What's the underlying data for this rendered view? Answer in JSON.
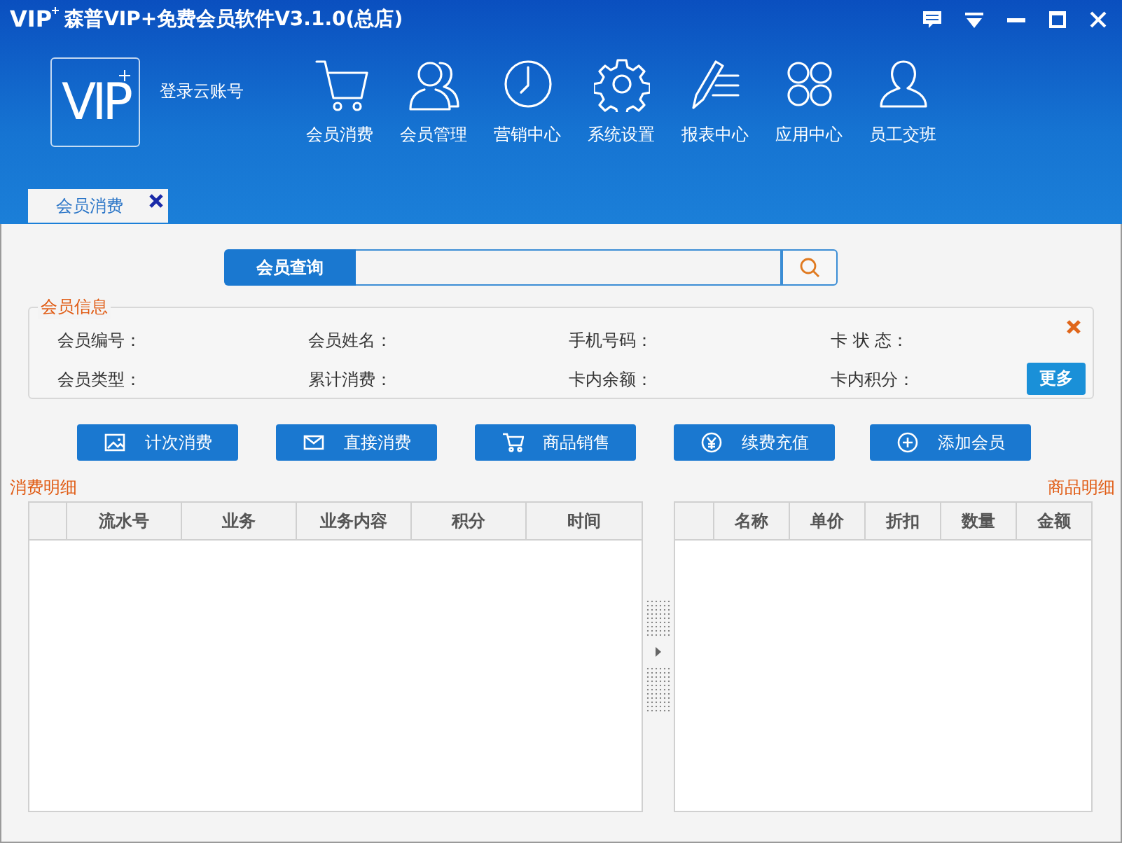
{
  "window": {
    "logo": "VIP",
    "title": "森普VIP+免费会员软件V3.1.0(总店)"
  },
  "account": {
    "logo": "VIP",
    "login": "登录云账号"
  },
  "nav": [
    {
      "kind": "cart",
      "label": "会员消费"
    },
    {
      "kind": "users",
      "label": "会员管理"
    },
    {
      "kind": "clock",
      "label": "营销中心"
    },
    {
      "kind": "gear",
      "label": "系统设置"
    },
    {
      "kind": "report",
      "label": "报表中心"
    },
    {
      "kind": "apps",
      "label": "应用中心"
    },
    {
      "kind": "user",
      "label": "员工交班"
    }
  ],
  "tabs": [
    {
      "label": "会员消费",
      "selected": true,
      "closable": true
    }
  ],
  "search": {
    "label": "会员查询"
  },
  "member_info": {
    "title": "会员信息",
    "fields": [
      "会员编号：",
      "会员姓名：",
      "手机号码：",
      "卡 状 态：",
      "会员类型：",
      "累计消费：",
      "卡内余额：",
      "卡内积分："
    ],
    "more_button": "更多"
  },
  "actions": [
    {
      "kind": "image",
      "label": "计次消费"
    },
    {
      "kind": "mail",
      "label": "直接消费"
    },
    {
      "kind": "cart",
      "label": "商品销售"
    },
    {
      "kind": "yen",
      "label": "续费充值"
    },
    {
      "kind": "plus",
      "label": "添加会员"
    }
  ],
  "consumption_table": {
    "title": "消费明细",
    "columns": [
      "流水号",
      "业务",
      "业务内容",
      "积分",
      "时间"
    ]
  },
  "goods_table": {
    "title": "商品明细",
    "columns": [
      "名称",
      "单价",
      "折扣",
      "数量",
      "金额"
    ]
  }
}
